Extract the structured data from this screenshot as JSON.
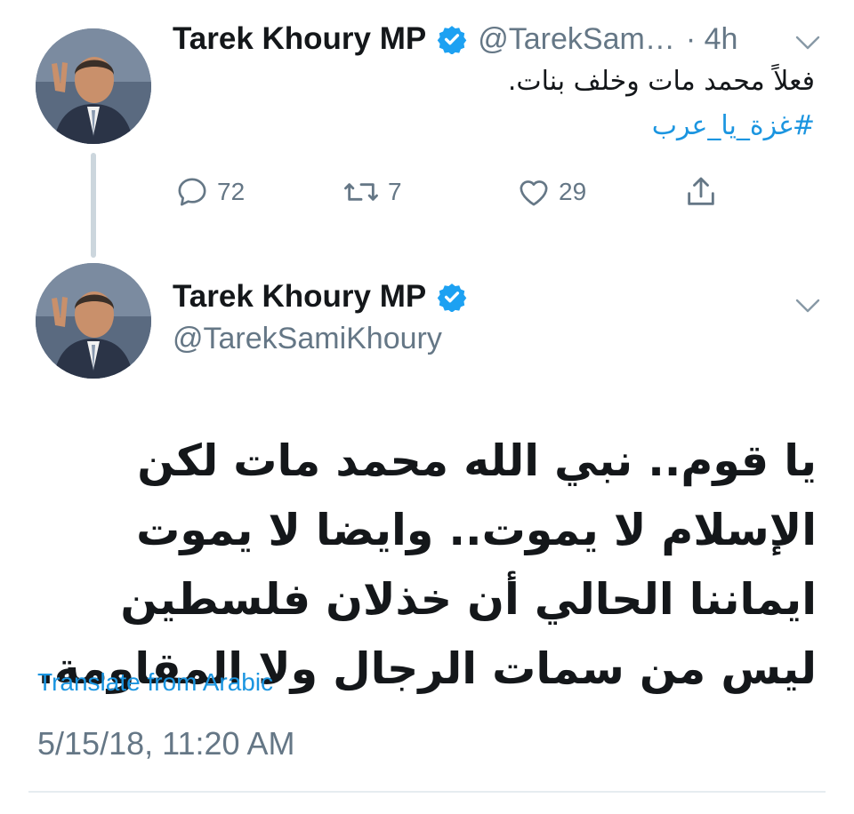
{
  "colors": {
    "link_blue": "#1b95e0",
    "secondary_gray": "#657786",
    "text": "#14171a",
    "verified_blue": "#1da1f2"
  },
  "parent_tweet": {
    "author_name": "Tarek Khoury MP",
    "verified_icon": "verified-badge-icon",
    "handle": "@TarekSam…",
    "time": "· 4h",
    "text": "فعلاً محمد مات وخلف بنات.",
    "hashtag": "#غزة_يا_عرب",
    "actions": {
      "reply_count": "72",
      "retweet_count": "7",
      "like_count": "29"
    }
  },
  "main_tweet": {
    "author_name": "Tarek Khoury MP",
    "handle": "@TarekSamiKhoury",
    "text": "يا قوم.. نبي الله محمد مات لكن الإسلام لا يموت.. وايضا لا يموت ايماننا الحالي أن خذلان فلسطين ليس من سمات الرجال ولا المقاومة.",
    "translate_label": "Translate from Arabic",
    "timestamp": "5/15/18, 11:20 AM"
  }
}
